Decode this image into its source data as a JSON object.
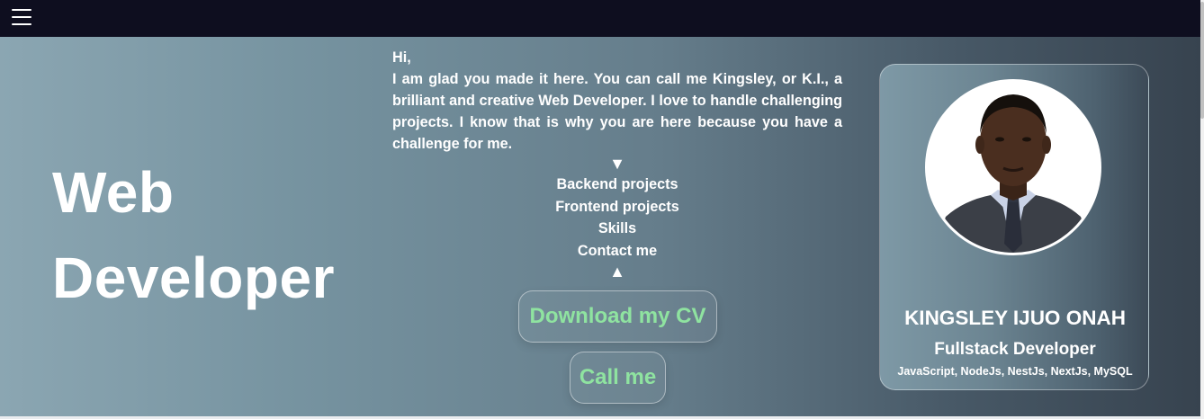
{
  "nav": {
    "menu_icon": "hamburger-menu-icon"
  },
  "hero": {
    "headline_line1": "Web",
    "headline_line2": "Developer",
    "intro_greeting": "Hi,",
    "intro_text": "I am glad you made it here. You can call me Kingsley, or K.I., a brilliant and creative Web Developer. I love to handle challenging projects. I know that is why you are here because you have a challenge for me.",
    "arrow_down": "▼",
    "arrow_up": "▲",
    "menu": [
      "Backend projects",
      "Frontend projects",
      "Skills",
      "Contact me"
    ],
    "download_cv_label": "Download my CV",
    "call_label": "Call me"
  },
  "profile": {
    "name": "KINGSLEY IJUO ONAH",
    "role": "Fullstack Developer",
    "skills": "JavaScript, NodeJs, NestJs, NextJs, MySQL"
  },
  "colors": {
    "topbar": "#0e0e1f",
    "button_text": "#8fe3a0",
    "hero_gradient_start": "#8ba6b2",
    "hero_gradient_end": "#37434f"
  }
}
